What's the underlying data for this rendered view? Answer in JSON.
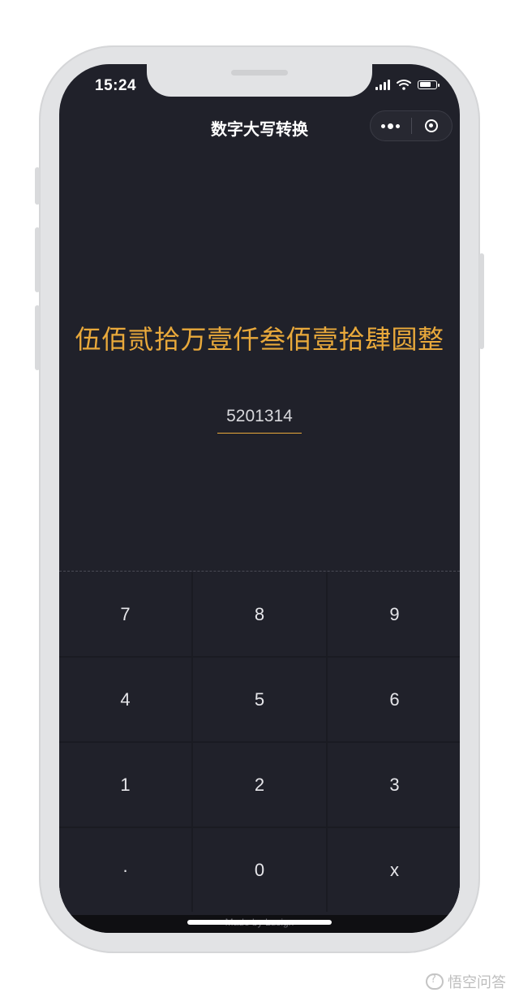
{
  "status_bar": {
    "time": "15:24"
  },
  "nav": {
    "title": "数字大写转换"
  },
  "result": {
    "text": "伍佰贰拾万壹仟叁佰壹拾肆圆整"
  },
  "input": {
    "value": "5201314"
  },
  "keypad": {
    "keys": [
      "7",
      "8",
      "9",
      "4",
      "5",
      "6",
      "1",
      "2",
      "3",
      "·",
      "0",
      "x"
    ]
  },
  "footer": {
    "text": "Made by Lusign"
  },
  "watermark": {
    "text": "悟空问答"
  },
  "colors": {
    "accent": "#e9a93b",
    "background": "#20212a"
  }
}
